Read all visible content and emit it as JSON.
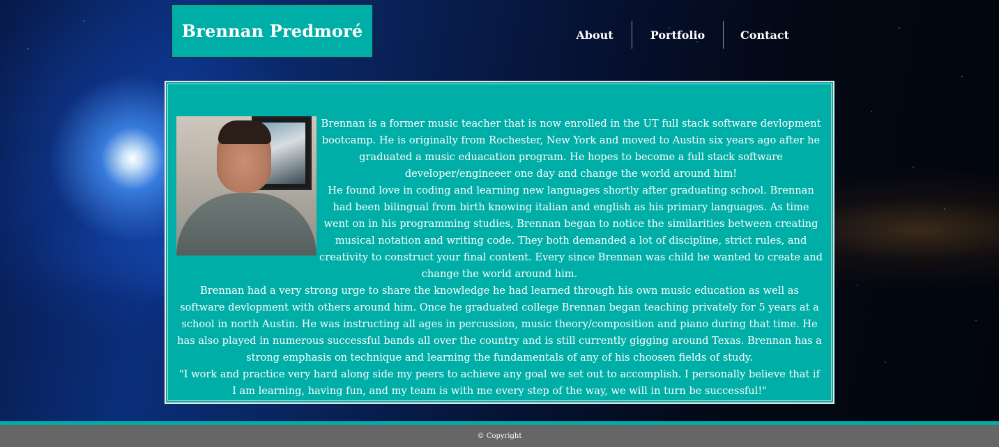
{
  "header": {
    "brand_name": "Brennan Predmoré",
    "nav": [
      {
        "label": "About"
      },
      {
        "label": "Portfolio"
      },
      {
        "label": "Contact"
      }
    ]
  },
  "about": {
    "photo_alt": "profile photo",
    "paragraphs": [
      "Brennan is a former music teacher that is now enrolled in the UT full stack software devlopment bootcamp. He is originally from Rochester, New York and moved to Austin six years ago after he graduated a music eduacation program. He hopes to become a full stack software developer/engineeer one day and change the world around him!",
      "He found love in coding and learning new languages shortly after graduating school. Brennan had been bilingual from birth knowing italian and english as his primary languages. As time went on in his programming studies, Brennan began to notice the similarities between creating musical notation and writing code. They both demanded a lot of discipline, strict rules, and creativity to construct your final content. Every since Brennan was child he wanted to create and change the world around him.",
      "Brennan had a very strong urge to share the knowledge he had learned through his own music education as well as software devlopment with others around him. Once he graduated college Brennan began teaching privately for 5 years at a school in north Austin. He was instructing all ages in percussion, music theory/composition and piano during that time. He has also played in numerous successful bands all over the country and is still currently gigging around Texas. Brennan has a strong emphasis on technique and learning the fundamentals of any of his choosen fields of study.",
      "\"I work and practice very hard along side my peers to achieve any goal we set out to accomplish. I personally believe that if I am learning, having fun, and my team is with me every step of the way, we will in turn be successful!\""
    ]
  },
  "footer": {
    "copyright": "© Copyright"
  },
  "colors": {
    "accent": "#00aea8",
    "footer_bg": "#666666",
    "text": "#ffffff"
  }
}
